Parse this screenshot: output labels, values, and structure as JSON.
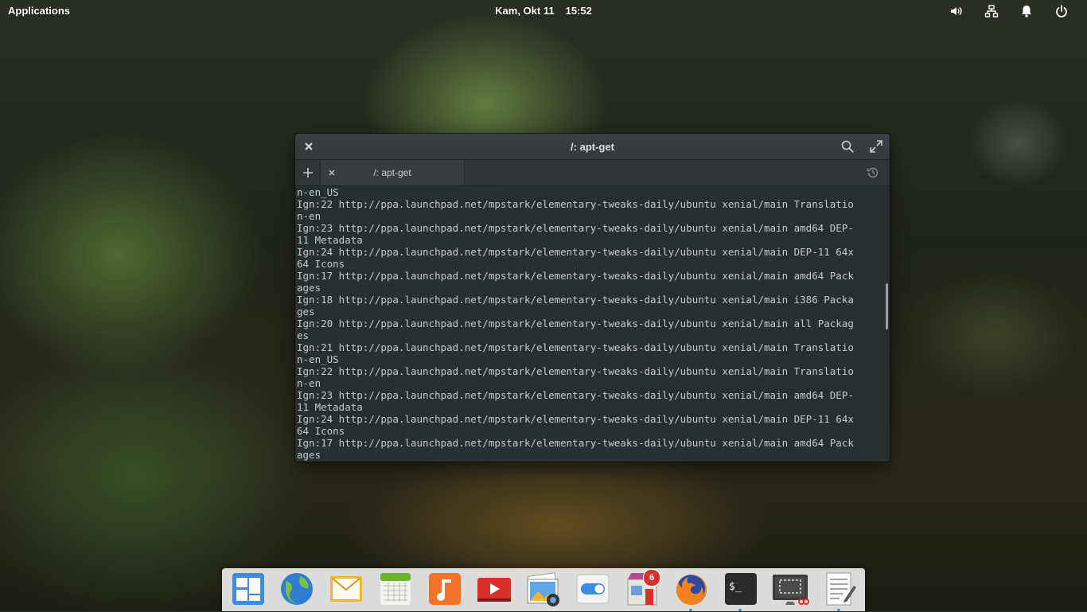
{
  "panel": {
    "applications_label": "Applications",
    "date": "Kam, Okt 11",
    "time": "15:52",
    "tray_icons": [
      "volume-icon",
      "network-icon",
      "notifications-icon",
      "power-icon"
    ]
  },
  "window": {
    "title": "/: apt-get",
    "tab_label": "/: apt-get"
  },
  "terminal_lines": [
    "n-en_US",
    "Ign:22 http://ppa.launchpad.net/mpstark/elementary-tweaks-daily/ubuntu xenial/main Translatio",
    "n-en",
    "Ign:23 http://ppa.launchpad.net/mpstark/elementary-tweaks-daily/ubuntu xenial/main amd64 DEP-",
    "11 Metadata",
    "Ign:24 http://ppa.launchpad.net/mpstark/elementary-tweaks-daily/ubuntu xenial/main DEP-11 64x",
    "64 Icons",
    "Ign:17 http://ppa.launchpad.net/mpstark/elementary-tweaks-daily/ubuntu xenial/main amd64 Pack",
    "ages",
    "Ign:18 http://ppa.launchpad.net/mpstark/elementary-tweaks-daily/ubuntu xenial/main i386 Packa",
    "ges",
    "Ign:20 http://ppa.launchpad.net/mpstark/elementary-tweaks-daily/ubuntu xenial/main all Packag",
    "es",
    "Ign:21 http://ppa.launchpad.net/mpstark/elementary-tweaks-daily/ubuntu xenial/main Translatio",
    "n-en_US",
    "Ign:22 http://ppa.launchpad.net/mpstark/elementary-tweaks-daily/ubuntu xenial/main Translatio",
    "n-en",
    "Ign:23 http://ppa.launchpad.net/mpstark/elementary-tweaks-daily/ubuntu xenial/main amd64 DEP-",
    "11 Metadata",
    "Ign:24 http://ppa.launchpad.net/mpstark/elementary-tweaks-daily/ubuntu xenial/main DEP-11 64x",
    "64 Icons",
    "Ign:17 http://ppa.launchpad.net/mpstark/elementary-tweaks-daily/ubuntu xenial/main amd64 Pack",
    "ages"
  ],
  "dock": {
    "items": [
      "multitasking-view",
      "web-browser",
      "mail",
      "calendar",
      "music",
      "videos",
      "photos",
      "system-settings",
      "appcenter",
      "firefox",
      "terminal",
      "screenshot",
      "text-editor"
    ],
    "appcenter_badge": "6",
    "running": [
      "firefox",
      "terminal",
      "text-editor"
    ]
  },
  "colors": {
    "accent": "#3a8fd9",
    "badge": "#d9302b",
    "terminal_bg": "#283034",
    "terminal_fg": "#c7cacb"
  }
}
